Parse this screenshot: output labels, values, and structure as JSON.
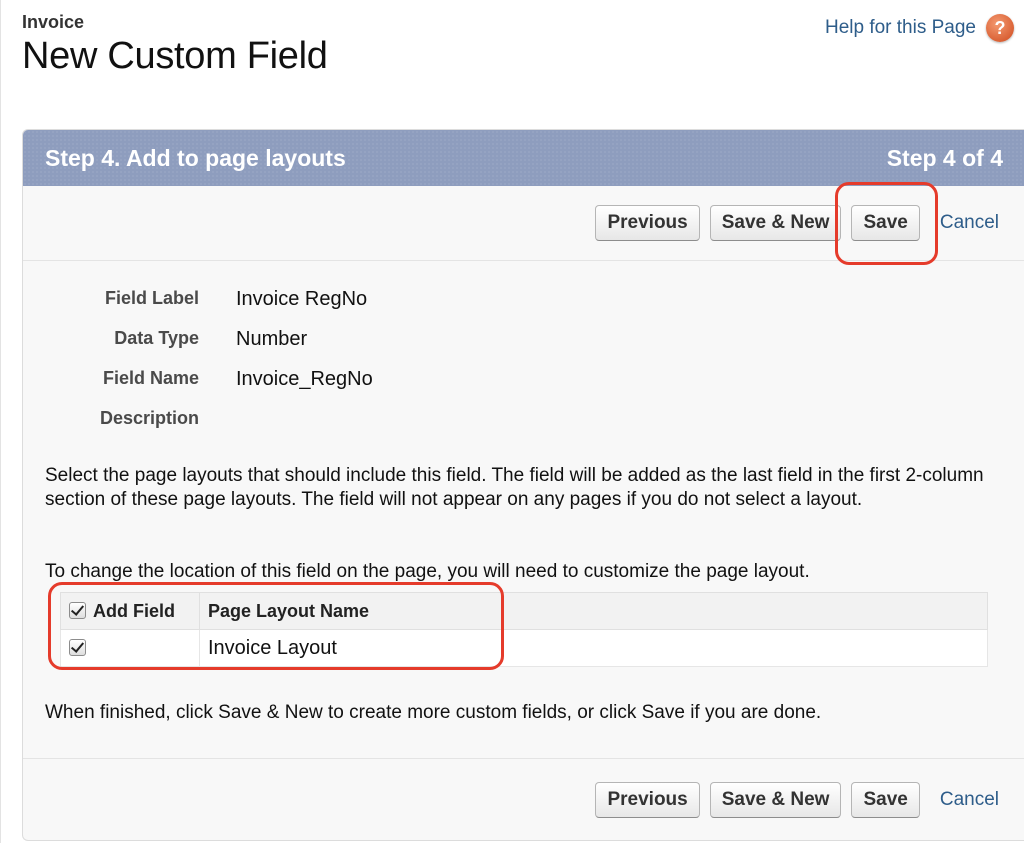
{
  "header": {
    "object_name": "Invoice",
    "page_title": "New Custom Field",
    "help_link": "Help for this Page",
    "help_icon": "?"
  },
  "step_bar": {
    "title": "Step 4. Add to page layouts",
    "progress": "Step 4 of 4"
  },
  "buttons": {
    "previous": "Previous",
    "save_new": "Save & New",
    "save": "Save",
    "cancel": "Cancel"
  },
  "fields": [
    {
      "label": "Field Label",
      "value": "Invoice RegNo"
    },
    {
      "label": "Data Type",
      "value": "Number"
    },
    {
      "label": "Field Name",
      "value": "Invoice_RegNo"
    },
    {
      "label": "Description",
      "value": ""
    }
  ],
  "instructions": {
    "select_layouts": "Select the page layouts that should include this field. The field will be added as the last field in the first 2-column section of these page layouts. The field will not appear on any pages if you do not select a layout.",
    "change_location": "To change the location of this field on the page, you will need to customize the page layout.",
    "finished": "When finished, click Save & New to create more custom fields, or click Save if you are done."
  },
  "layout_table": {
    "columns": [
      "Add Field",
      "Page Layout Name"
    ],
    "header_checked": true,
    "rows": [
      {
        "checked": true,
        "name": "Invoice Layout"
      }
    ]
  },
  "colors": {
    "step_header": "#8e9dbe",
    "link": "#2e5d8a",
    "highlight": "#e53b2b"
  }
}
